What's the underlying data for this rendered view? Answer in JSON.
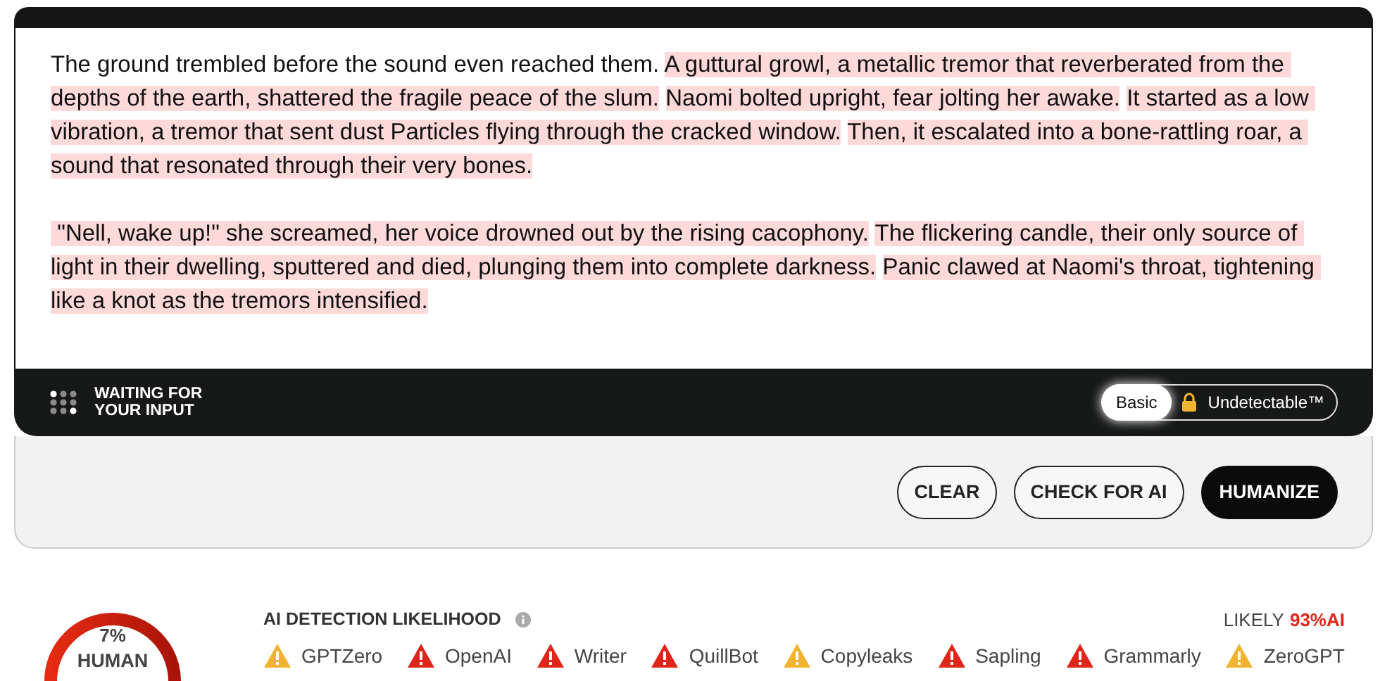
{
  "editor": {
    "paragraphs": [
      {
        "sentences": [
          {
            "text": "The ground trembled before the sound even reached them.",
            "flagged": false
          },
          {
            "text": "A guttural growl, a metallic tremor that reverberated from the depths of the earth, shattered the fragile peace of the slum.",
            "flagged": true
          },
          {
            "text": "Naomi bolted upright, fear jolting her awake.",
            "flagged": true
          },
          {
            "text": "It started as a low vibration, a tremor that sent dust Particles flying through the cracked window.",
            "flagged": true
          },
          {
            "text": "Then, it escalated into a bone-rattling roar, a sound that resonated through their very bones.",
            "flagged": true
          }
        ]
      },
      {
        "sentences": [
          {
            "text": " \"Nell, wake up!\" she screamed, her voice drowned out by the rising cacophony.",
            "flagged": true
          },
          {
            "text": "The flickering candle, their only source of light in their dwelling, sputtered and died, plunging them into complete darkness.",
            "flagged": true
          },
          {
            "text": "Panic clawed at Naomi's throat, tightening like a knot as the tremors intensified.",
            "flagged": true
          }
        ]
      }
    ]
  },
  "status_bar": {
    "status": [
      "WAITING FOR",
      "YOUR INPUT"
    ],
    "modes": [
      {
        "label": "Basic",
        "selected": true,
        "locked": false
      },
      {
        "label": "Undetectable™",
        "selected": false,
        "locked": true
      }
    ]
  },
  "buttons": [
    {
      "label": "CLEAR",
      "kind": "outline"
    },
    {
      "label": "CHECK FOR AI",
      "kind": "outline"
    },
    {
      "label": "HUMANIZE",
      "kind": "primary"
    }
  ],
  "results": {
    "gauge": {
      "value": "7%",
      "label": "HUMAN"
    },
    "title": "AI DETECTION LIKELIHOOD",
    "verdict": "LIKELY",
    "score": "93%AI",
    "detectors": [
      {
        "name": "GPTZero",
        "color": "#f2b330"
      },
      {
        "name": "OpenAI",
        "color": "#e0261b"
      },
      {
        "name": "Writer",
        "color": "#e0261b"
      },
      {
        "name": "QuillBot",
        "color": "#e0261b"
      },
      {
        "name": "Copyleaks",
        "color": "#f2b330"
      },
      {
        "name": "Sapling",
        "color": "#e0261b"
      },
      {
        "name": "Grammarly",
        "color": "#e0261b"
      },
      {
        "name": "ZeroGPT",
        "color": "#f2b330"
      }
    ]
  }
}
